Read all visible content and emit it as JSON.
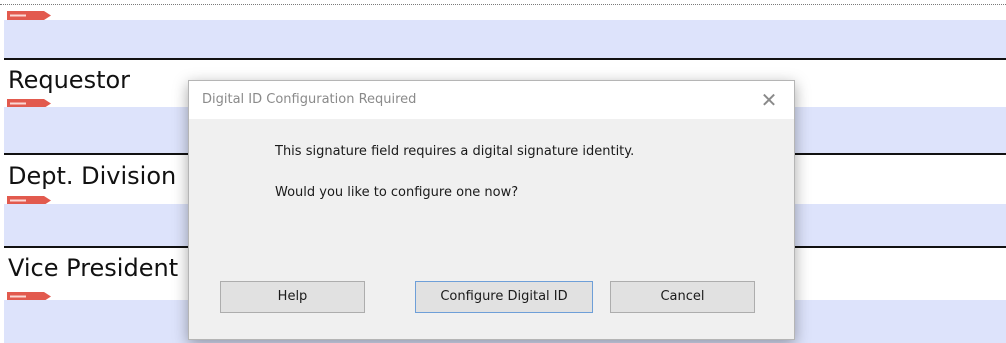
{
  "form": {
    "sections": [
      {
        "label": ""
      },
      {
        "label": "Requestor"
      },
      {
        "label": "Dept. Division"
      },
      {
        "label": "Vice President"
      }
    ],
    "sign_tag_color": "#e25a4e"
  },
  "dialog": {
    "title": "Digital ID Configuration Required",
    "close_symbol": "✕",
    "message_line1": "This signature field requires a digital signature identity.",
    "message_line2": "Would you like to configure one now?",
    "buttons": {
      "help": "Help",
      "configure": "Configure Digital ID",
      "cancel": "Cancel"
    }
  }
}
